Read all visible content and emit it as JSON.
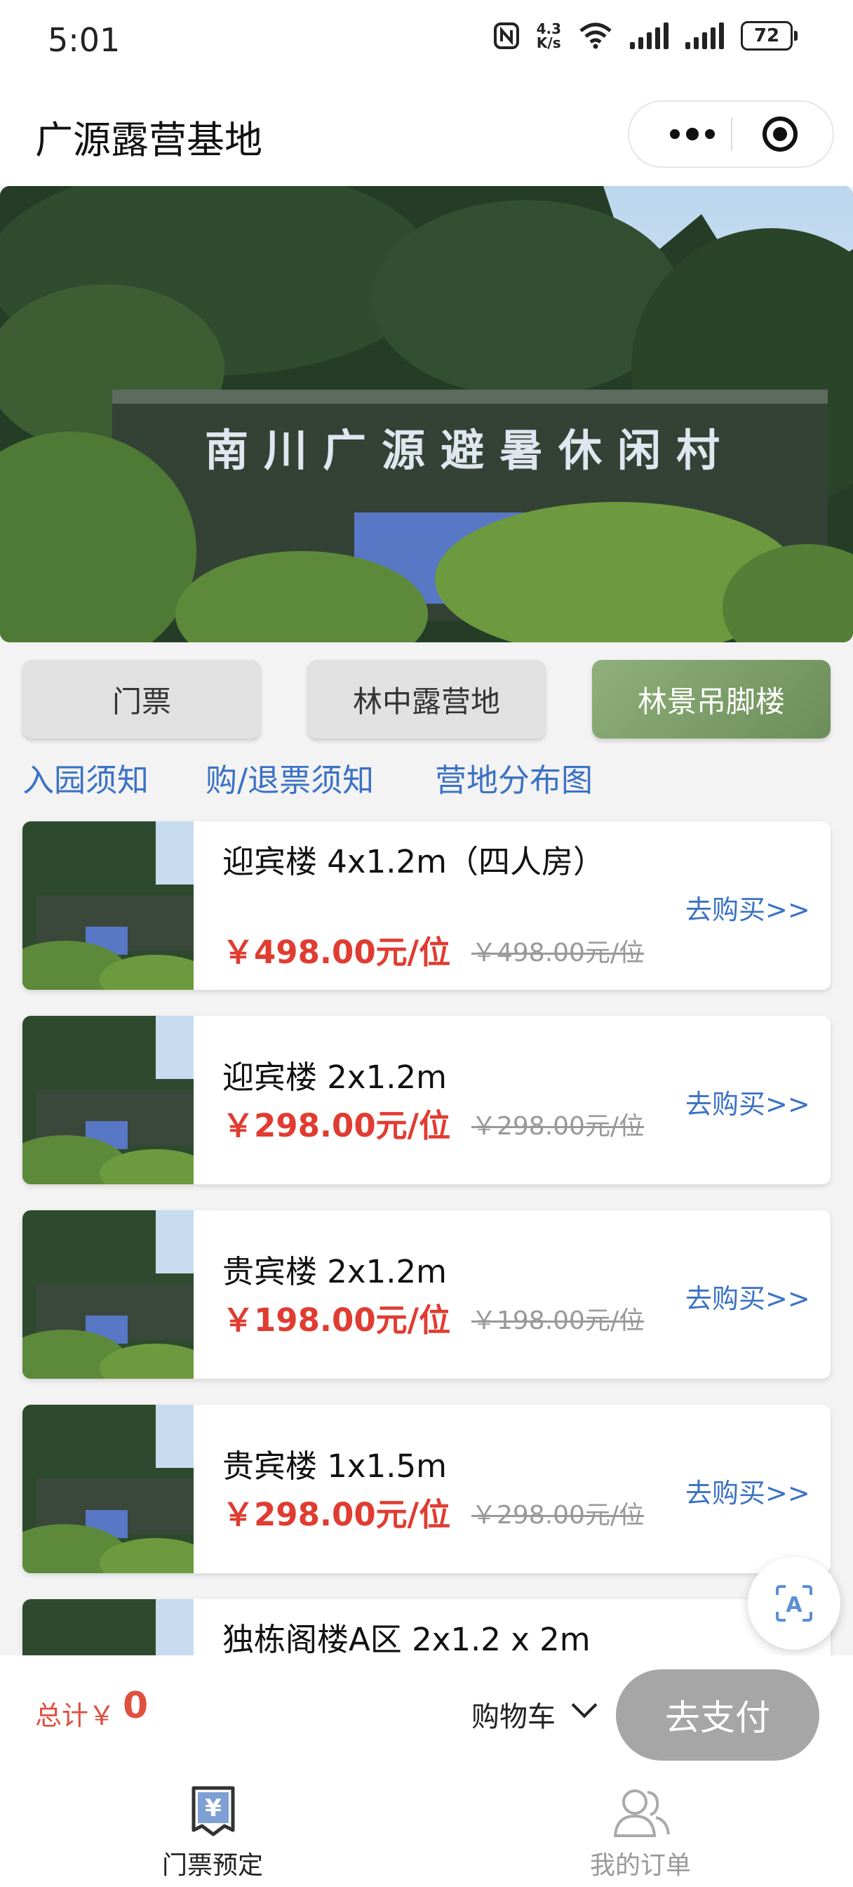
{
  "status_bar": {
    "time": "5:01",
    "speed": "4.3\nK/s",
    "battery": "72"
  },
  "header": {
    "title": "广源露营基地"
  },
  "hero": {
    "sign_text": "南川广源避暑休闲村"
  },
  "tabs": [
    {
      "label": "门票",
      "active": false
    },
    {
      "label": "林中露营地",
      "active": false
    },
    {
      "label": "林景吊脚楼",
      "active": true
    }
  ],
  "links": [
    "入园须知",
    "购/退票须知",
    "营地分布图"
  ],
  "products": [
    {
      "name": "迎宾楼 4x1.2m（四人房）",
      "price": "￥498.00元/位",
      "original_price": "￥498.00元/位",
      "action": "去购买>>"
    },
    {
      "name": "迎宾楼 2x1.2m",
      "price": "￥298.00元/位",
      "original_price": "￥298.00元/位",
      "action": "去购买>>"
    },
    {
      "name": "贵宾楼 2x1.2m",
      "price": "￥198.00元/位",
      "original_price": "￥198.00元/位",
      "action": "去购买>>"
    },
    {
      "name": "贵宾楼 1x1.5m",
      "price": "￥298.00元/位",
      "original_price": "￥298.00元/位",
      "action": "去购买>>"
    },
    {
      "name": "独栋阁楼A区 2x1.2 x 2m"
    }
  ],
  "cart": {
    "total_label": "总计￥",
    "total_value": "0",
    "cart_label": "购物车",
    "pay_label": "去支付"
  },
  "bottom_nav": [
    {
      "label": "门票预定",
      "icon": "ticket-yen-icon",
      "active": true
    },
    {
      "label": "我的订单",
      "icon": "users-icon",
      "active": false
    }
  ],
  "colors": {
    "accent_green": "#7a9c66",
    "link_blue": "#3b72c4",
    "price_red": "#e03c31"
  }
}
